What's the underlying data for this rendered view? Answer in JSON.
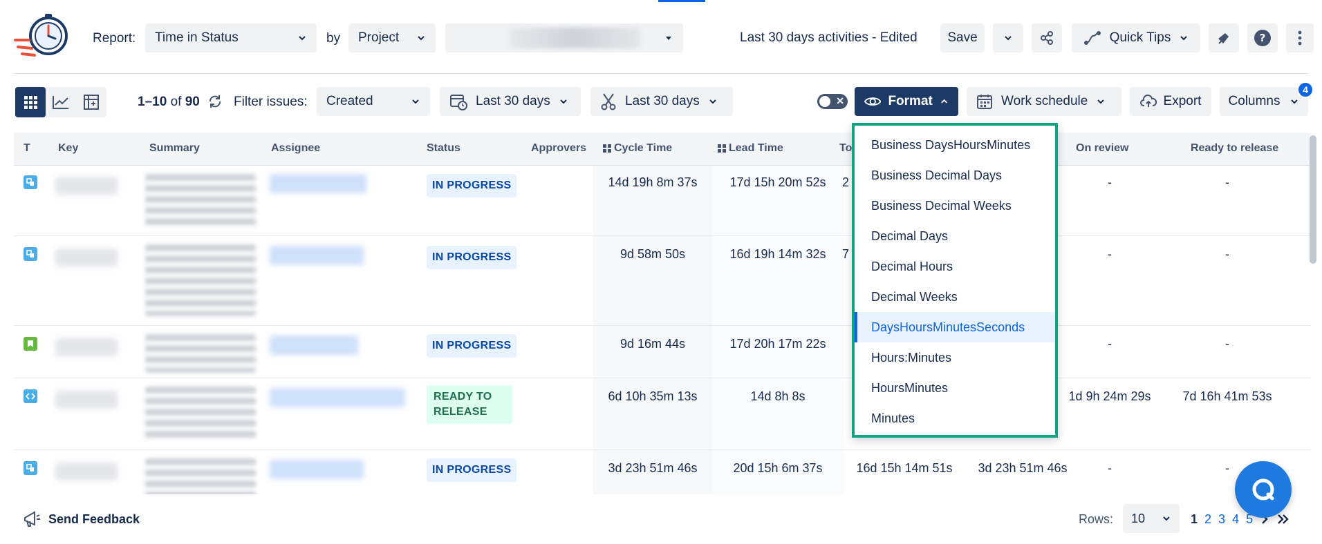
{
  "header": {
    "report_label": "Report:",
    "report_value": "Time in Status",
    "by_label": "by",
    "by_value": "Project",
    "activities": "Last 30 days activities - Edited",
    "save": "Save",
    "quick_tips": "Quick Tips"
  },
  "toolbar": {
    "range_bold": "1–10",
    "range_of": "of",
    "range_total": "90",
    "filter_label": "Filter issues:",
    "filter_value": "Created",
    "date_filter_1": "Last 30 days",
    "date_filter_2": "Last 30 days",
    "format": "Format",
    "work_schedule": "Work schedule",
    "export": "Export",
    "columns": "Columns",
    "columns_badge": "4"
  },
  "table": {
    "headers": {
      "t": "T",
      "key": "Key",
      "summary": "Summary",
      "assignee": "Assignee",
      "status": "Status",
      "approvers": "Approvers",
      "cycle_time": "Cycle Time",
      "lead_time": "Lead Time",
      "to": "To",
      "on_review": "On review",
      "ready_to_release": "Ready to release"
    },
    "rows": [
      {
        "status": "IN PROGRESS",
        "cycle": "14d 19h 8m 37s",
        "lead": "17d 15h 20m 52s",
        "c3": "2",
        "c4": "",
        "review": "-",
        "ready": "-"
      },
      {
        "status": "IN PROGRESS",
        "cycle": "9d 58m 50s",
        "lead": "16d 19h 14m 32s",
        "c3": "7",
        "c4": "",
        "review": "-",
        "ready": "-"
      },
      {
        "status": "IN PROGRESS",
        "cycle": "9d 16m 44s",
        "lead": "17d 20h 17m 22s",
        "c3": "",
        "c4": "",
        "review": "-",
        "ready": "-"
      },
      {
        "status": "READY TO RELEASE",
        "cycle": "6d 10h 35m 13s",
        "lead": "14d 8h 8s",
        "c3": "",
        "c4": "",
        "review": "1d 9h 24m 29s",
        "ready": "7d 16h 41m 53s"
      },
      {
        "status": "IN PROGRESS",
        "cycle": "3d 23h 51m 46s",
        "lead": "20d 15h 6m 37s",
        "c3": "16d 15h 14m 51s",
        "c4": "3d 23h 51m 46s",
        "review": "-",
        "ready": "-"
      }
    ]
  },
  "format_menu": {
    "items": [
      "Business DaysHoursMinutes",
      "Business Decimal Days",
      "Business Decimal Weeks",
      "Decimal Days",
      "Decimal Hours",
      "Decimal Weeks",
      "DaysHoursMinutesSeconds",
      "Hours:Minutes",
      "HoursMinutes",
      "Minutes"
    ],
    "selected": "DaysHoursMinutesSeconds"
  },
  "footer": {
    "feedback": "Send Feedback",
    "rows_label": "Rows:",
    "rows_value": "10",
    "pages": [
      "1",
      "2",
      "3",
      "4",
      "5"
    ],
    "current_page": "1"
  },
  "colors": {
    "primary_dark": "#1d3a66",
    "accent_blue": "#0c66e4",
    "menu_border": "#10a37f",
    "chat_bg": "#1f7ae0"
  }
}
